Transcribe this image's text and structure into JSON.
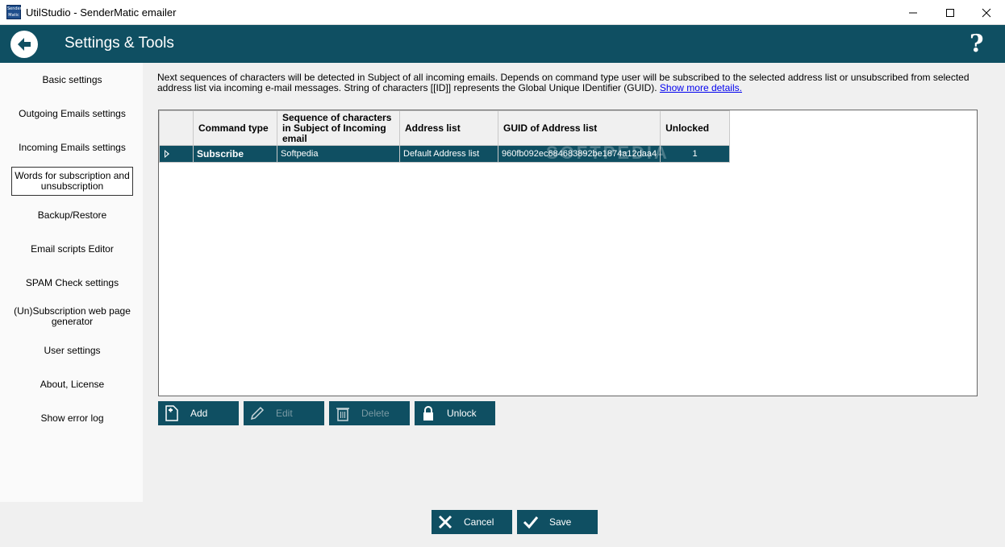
{
  "window": {
    "title": "UtilStudio - SenderMatic emailer",
    "icon_text": "Sender Matic"
  },
  "header": {
    "title": "Settings & Tools",
    "help_label": "?"
  },
  "sidebar": {
    "items": [
      {
        "label": "Basic settings"
      },
      {
        "label": "Outgoing Emails settings"
      },
      {
        "label": "Incoming Emails settings"
      },
      {
        "label": "Words for subscription and unsubscription"
      },
      {
        "label": "Backup/Restore"
      },
      {
        "label": "Email scripts Editor"
      },
      {
        "label": "SPAM Check settings"
      },
      {
        "label": "(Un)Subscription web page generator"
      },
      {
        "label": "User settings"
      },
      {
        "label": "About, License"
      },
      {
        "label": "Show error log"
      }
    ],
    "active_index": 3
  },
  "main": {
    "description": "Next sequences of characters will be detected in Subject of all incoming emails. Depends on command type user will be subscribed to the selected address list or unsubscribed from selected address list via incoming e-mail messages. String of characters [[ID]] represents the Global Unique IDentifier (GUID). ",
    "details_link": "Show more details.",
    "table": {
      "columns": [
        "Command type",
        "Sequence of characters in Subject of Incoming email",
        "Address list",
        "GUID of Address list",
        "Unlocked"
      ],
      "rows": [
        [
          "Subscribe",
          "Softpedia",
          "Default Address list",
          "960fb092ec684683892be1874a12daa4",
          "1"
        ]
      ]
    },
    "watermark": "SOFTPEDIA",
    "actions": {
      "add": "Add",
      "edit": "Edit",
      "delete": "Delete",
      "unlock": "Unlock"
    }
  },
  "footer": {
    "cancel": "Cancel",
    "save": "Save"
  },
  "colors": {
    "accent": "#0f4f62",
    "header_bg": "#0f4f62",
    "sidebar_bg": "#fafafa",
    "content_bg": "#f0f0f0"
  }
}
